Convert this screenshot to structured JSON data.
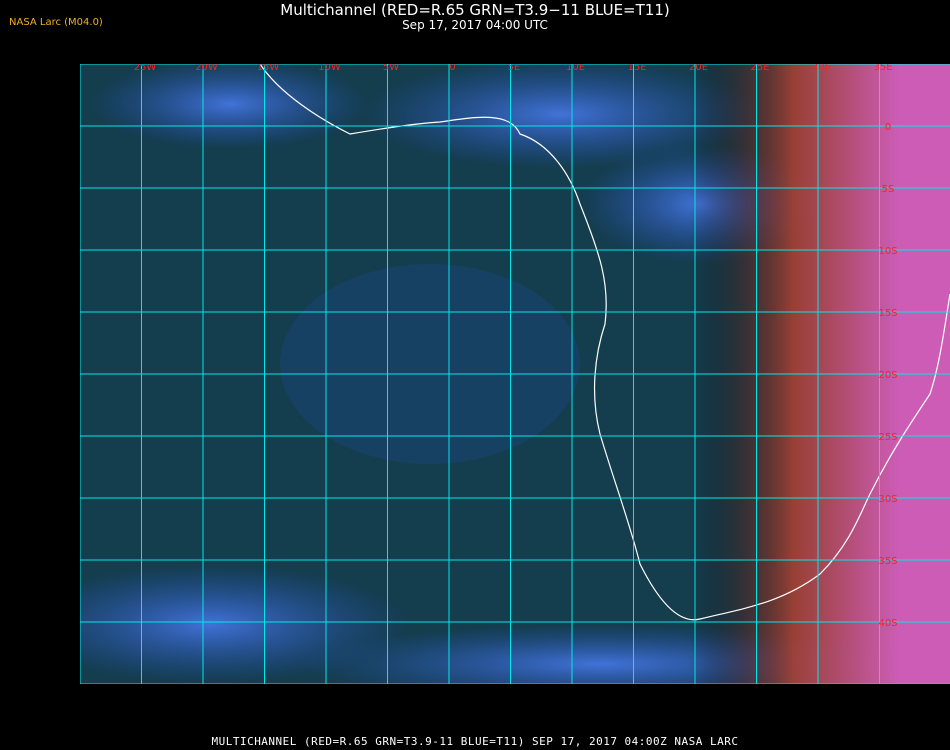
{
  "header": {
    "title": "Multichannel (RED=R.65 GRN=T3.9−11 BLUE=T11)",
    "subtitle": "Sep 17, 2017 04:00 UTC",
    "source": "NASA Larc (M04.0)"
  },
  "footer": {
    "label": "MULTICHANNEL (RED=R.65 GRN=T3.9-11 BLUE=T11) SEP 17, 2017 04:00Z  NASA LARC"
  },
  "map": {
    "longitude_labels": [
      "25W",
      "20W",
      "15W",
      "10W",
      "5W",
      "0",
      "5E",
      "10E",
      "15E",
      "20E",
      "25E",
      "30E",
      "35E"
    ],
    "latitude_labels": [
      "0",
      "5S",
      "10S",
      "15S",
      "20S",
      "25S",
      "30S",
      "35S",
      "40S"
    ],
    "colors": {
      "grid": "#00e8e8",
      "tick_labels": "#ff2020",
      "ocean": "#1b3d7a",
      "land_night": "#0f3e2a",
      "cloud": "#3c6fe8",
      "daylight_edge": "#e060c0",
      "coastline": "#ffffff"
    }
  }
}
